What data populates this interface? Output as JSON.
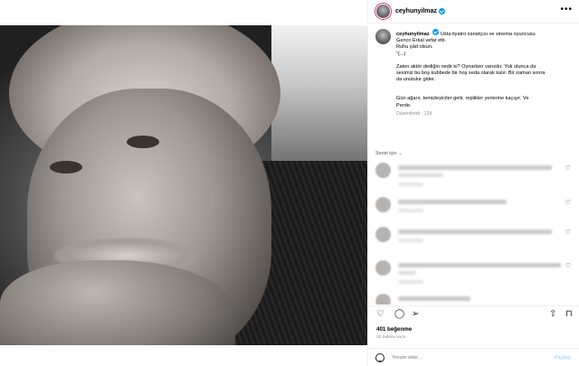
{
  "post": {
    "username": "ceyhunyilmaz",
    "photo_alt": "black and white portrait",
    "caption_lines": [
      "Usta tiyatro sanatçısı ve sinema oyuncusu",
      "Genco Erkal vefat etti.",
      "Ruhu şâd olsun.",
      "\"(...)"
    ],
    "caption_para2": [
      "Zaten aktör dediğin nedir ki? Oynarken varızdır. Yok olunca da",
      "sesimiz bu boş kubbede bir hoş seda olarak kalır. Bir zaman sonra",
      "da unutulur gider."
    ],
    "caption_para3": [
      "Gün ağarır, temizleyiciler gelir, replikler yerlerine kaçışır. Ve",
      "Perde."
    ],
    "edited": "Düzenlendi · 12d",
    "for_you": "Senin için",
    "likes": "401 beğenme",
    "time_ago": "20 dakika önce",
    "comment_placeholder": "Yorum ekle...",
    "post_button": "Paylaş"
  },
  "icons": {
    "more": "more-horizontal-icon",
    "heart": "heart-icon",
    "comment": "comment-icon",
    "share": "share-icon",
    "save": "bookmark-icon",
    "emoji": "emoji-icon"
  },
  "colors": {
    "accent": "#0095f6",
    "story_ring": "#d62976",
    "muted": "#8e8e8e"
  }
}
